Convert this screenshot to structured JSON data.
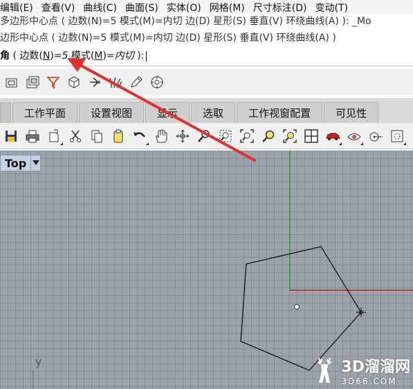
{
  "menu": {
    "items": [
      "编辑(E)",
      "查看(V)",
      "曲线(C)",
      "曲面(S)",
      "实体(O)",
      "网格(M)",
      "尺寸标注(D)",
      "变动(T)"
    ]
  },
  "command": {
    "history_1": "多边形中心点 ( 边数(N)=5  模式(M)=内切  边(D)  星形(S)  垂直(V)  环绕曲线(A) ): _Mo",
    "history_2": "边形中心点 ( 边数(N)=5  模式(M)=内切  边(D)  星形(S)  垂直(V)  环绕曲线(A) )",
    "prompt_name": "角",
    "prompt_open": " ( 边数(",
    "prompt_key_n": "N",
    "prompt_eq_n": ")=",
    "prompt_val_n": "5",
    "prompt_mode": "  模式(",
    "prompt_key_m": "M",
    "prompt_eq_m": ")=",
    "prompt_val_m": "内切",
    "prompt_close": " ):"
  },
  "tabs": [
    "工作平面",
    "设置视图",
    "显示",
    "选取",
    "工作视窗配置",
    "可见性"
  ],
  "toolbar_top_icons": [
    "layer-icon",
    "layers-icon",
    "filter-icon",
    "box-icon",
    "bulb-icon",
    "grass-icon",
    "pencil-icon",
    "target-icon"
  ],
  "toolbar_main_icons": [
    "save-icon",
    "print-icon",
    "import-icon",
    "cut-icon",
    "copy-icon",
    "paste-icon",
    "undo-icon",
    "pan-hand-icon",
    "rotate-icon",
    "zoom-icon",
    "zoom-window-icon",
    "zoom-extents-icon",
    "zoom-selected-icon",
    "zoom-all-icon",
    "four-view-icon",
    "car-icon",
    "render-icon",
    "osnap-icon",
    "gumball-icon"
  ],
  "viewport": {
    "label": "Top",
    "axis_y_label": "y"
  },
  "watermark": {
    "big": "3D溜溜网",
    "small": "3D66.COM"
  },
  "colors": {
    "viewport_bg": "#9da3ab",
    "x_axis": "#c02020",
    "y_axis": "#20a020",
    "arrow": "#e03030"
  }
}
